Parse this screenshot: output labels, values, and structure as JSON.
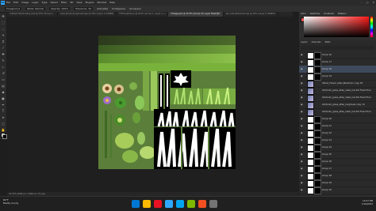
{
  "app": {
    "logo": "Ps",
    "brand_color": "#31a8ff"
  },
  "menubar": {
    "items": [
      "File",
      "Edit",
      "Image",
      "Layer",
      "Type",
      "Select",
      "Filter",
      "3D",
      "View",
      "Plugins",
      "Window",
      "Help"
    ],
    "controls": [
      "–",
      "□",
      "✕"
    ]
  },
  "options": {
    "items": [
      "Foreground",
      "Mode: Normal",
      "Opacity: 100%",
      "Tolerance: 32",
      "Anti-alias",
      "Contiguous",
      "All Layers"
    ]
  },
  "tabs": [
    {
      "label": "Untitled Plants Atlas_leaf @ 50% (Group 1...",
      "active": false
    },
    {
      "label": "Leaf_Sheet_Roughness.tga @ 50% (Layer 0, RGB/8)",
      "active": false
    },
    {
      "label": "TTHGraphite.ai @ 100% (Group 1, Layer 4...)",
      "active": false
    },
    {
      "label": "Foliage.psd @ 33.3% (Group 10, Layer Mask/8)*",
      "active": true
    },
    {
      "label": "pbr_leaf_BaseColor.tga @ 50% (Layer 0, RGB/8)",
      "active": false
    }
  ],
  "status": {
    "zoom_doc": "33.33%    4096 px x 4096 px (72 ppi)"
  },
  "color_panel": {
    "tabs": [
      "Color",
      "Swatches",
      "Gradients",
      "Patterns"
    ]
  },
  "layers_panel": {
    "tabs": [
      "Layers",
      "Channels",
      "Paths"
    ],
    "layers": [
      {
        "name": "Group 16",
        "type": "mask",
        "selected": false
      },
      {
        "name": "Group 17",
        "type": "mask",
        "selected": false
      },
      {
        "name": "Group 18",
        "type": "mask",
        "selected": true
      },
      {
        "name": "Group 19",
        "type": "mask",
        "selected": false
      },
      {
        "name": "Yellow_Flower_Atlas_BaseColor copy 18",
        "type": "smart",
        "selected": false
      },
      {
        "name": "Ghidorah_grass_atlas_mask_low Poll Fixed Final copy 16",
        "type": "smart",
        "selected": false
      },
      {
        "name": "Ghidorah_grass_atlas_mask_low Poll Fixed Final copy 15",
        "type": "smart",
        "selected": false
      },
      {
        "name": "Ghidorah_grass_atlas_roughness copy 14",
        "type": "smart",
        "selected": false
      },
      {
        "name": "Ghidorah_grass_atlas_mask_low Poll Fixed Final copy 13",
        "type": "smart",
        "selected": false
      },
      {
        "name": "Group 20",
        "type": "mask",
        "selected": false
      },
      {
        "name": "Group 21",
        "type": "mask",
        "selected": false
      },
      {
        "name": "Group 22",
        "type": "mask",
        "selected": false
      },
      {
        "name": "Group 23",
        "type": "mask",
        "selected": false
      },
      {
        "name": "Group 24",
        "type": "mask",
        "selected": false
      },
      {
        "name": "Group 25",
        "type": "mask",
        "selected": false
      },
      {
        "name": "Group 26",
        "type": "mask",
        "selected": false
      },
      {
        "name": "Group 27",
        "type": "mask",
        "selected": false
      },
      {
        "name": "Group 28",
        "type": "mask",
        "selected": false
      },
      {
        "name": "Group 29",
        "type": "mask",
        "selected": false
      },
      {
        "name": "Group 30",
        "type": "mask",
        "selected": false
      }
    ]
  },
  "taskbar": {
    "weather_temp": "82°F",
    "weather_text": "Mostly cloudy",
    "time": "12:07 PM",
    "date": "7/16/2023",
    "icons": [
      "#0078d4",
      "#ffb900",
      "#e81123",
      "#31a8ff",
      "#00a4ef",
      "#7fba00",
      "#f25022",
      "#737373"
    ]
  }
}
